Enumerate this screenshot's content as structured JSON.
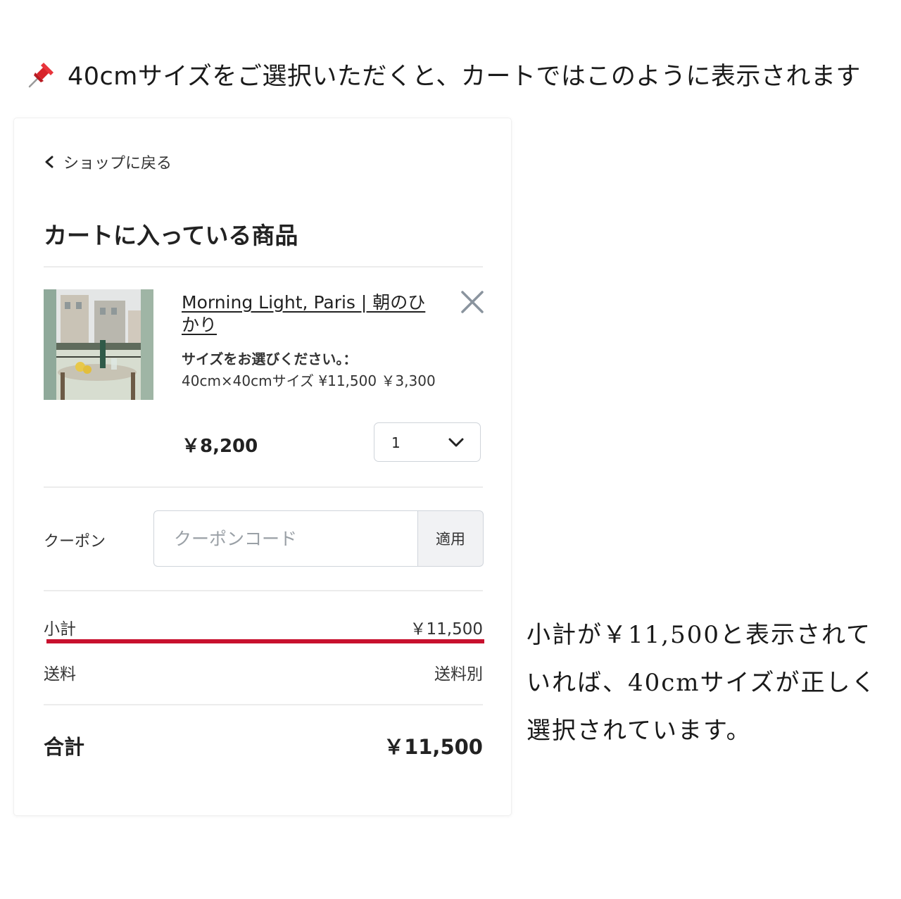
{
  "annotation": {
    "heading": "40cmサイズをご選択いただくと、カートではこのように表示されます",
    "note": "小計が￥11,500と表示されていれば、40cmサイズが正しく選択されています。"
  },
  "cart": {
    "back_label": "ショップに戻る",
    "title": "カートに入っている商品",
    "item": {
      "name": "Morning Light, Paris | 朝のひかり",
      "variant_label": "サイズをお選びください。：",
      "variant_value": "40cm×40cmサイズ ¥11,500 ￥3,300",
      "price": "￥8,200",
      "quantity": "1"
    },
    "coupon": {
      "label": "クーポン",
      "placeholder": "クーポンコード",
      "apply_label": "適用"
    },
    "subtotal": {
      "label": "小計",
      "value": "￥11,500"
    },
    "shipping": {
      "label": "送料",
      "value": "送料別"
    },
    "total": {
      "label": "合計",
      "value": "￥11,500"
    }
  },
  "colors": {
    "highlight": "#c8102e",
    "pin": "#d8232a"
  },
  "icons": {
    "pin": "pushpin-icon",
    "back": "chevron-left-icon",
    "remove": "close-icon",
    "dropdown": "chevron-down-icon"
  }
}
